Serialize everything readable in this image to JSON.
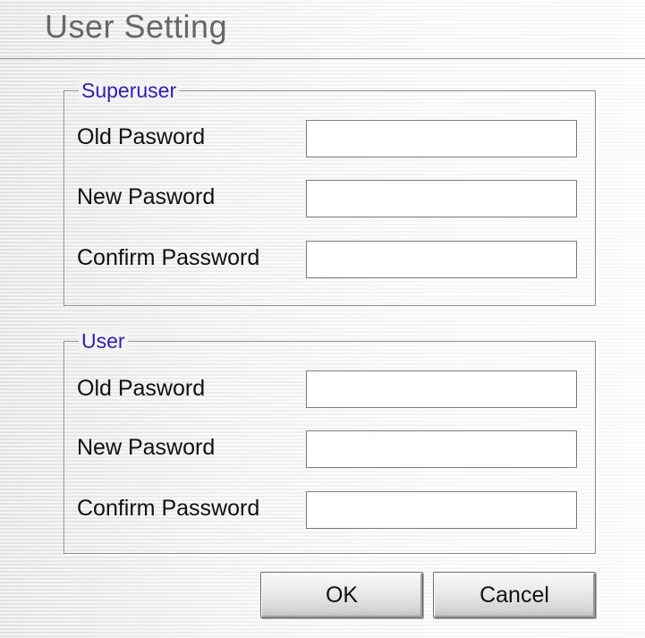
{
  "window": {
    "title": "User Setting"
  },
  "superuser": {
    "legend": "Superuser",
    "old_password_label": "Old Pasword",
    "old_password_value": "",
    "new_password_label": "New Pasword",
    "new_password_value": "",
    "confirm_password_label": "Confirm Password",
    "confirm_password_value": ""
  },
  "user": {
    "legend": "User",
    "old_password_label": "Old Pasword",
    "old_password_value": "",
    "new_password_label": "New Pasword",
    "new_password_value": "",
    "confirm_password_label": "Confirm Password",
    "confirm_password_value": ""
  },
  "buttons": {
    "ok_label": "OK",
    "cancel_label": "Cancel"
  },
  "colors": {
    "legend_text": "#2f1fb4",
    "title_text": "#666666"
  }
}
